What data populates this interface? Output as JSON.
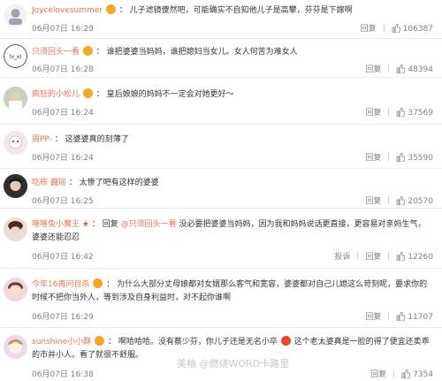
{
  "comments": [
    {
      "user": "Joycelovesummer",
      "badge": "emoji-orange",
      "text": "儿子滤镜傻然吧，可能确实不自知他儿子是高攀，芬芬是下嫁啊",
      "time": "06月07日 16:29",
      "reply": "回复",
      "likes": "106387"
    },
    {
      "user": "只须回头一看",
      "badge": "emoji-orange",
      "text": "谁把婆婆当妈妈，谁把媳妇当女儿。女人何苦为难女人",
      "time": "06月07日 16:28",
      "reply": "回复",
      "likes": "48394"
    },
    {
      "user": "疯狂的小松儿",
      "badge": "emoji-orange",
      "text": "皇后娘娘的妈妈不一定会对她更好～",
      "time": "06月07日 16:24",
      "reply": "回复",
      "likes": "37569"
    },
    {
      "user": "周PP-",
      "badge": "",
      "text": "这婆婆真的刻薄了",
      "time": "06月07日 16:24",
      "reply": "回复",
      "likes": "35590"
    },
    {
      "user": "吃栋 巍瑶",
      "badge": "",
      "text": "太惨了吧有这样的婆婆",
      "time": "06月07日 16:25",
      "reply": "回复",
      "likes": "20570"
    },
    {
      "user": "嘻嘻兔小魔王",
      "badge": "star",
      "text_prefix": "回复",
      "mention": "@只须回头一看",
      "text": "没必要把婆婆当妈妈，因为我和妈妈说话更直接，更容易对亲妈生气，婆婆还能忍忍",
      "time": "06月07日 16:42",
      "report": "投诉",
      "reply": "回复",
      "likes": "12260"
    },
    {
      "user": "今年16再问自杀",
      "badge": "emoji-orange",
      "text": "为什么大部分丈母娘都对女婿那么客气和宽容，婆婆都对自己儿媳这么苛刻呢，要求你的时候不把你当外人，等到涉及自身利益时，对不起你谁啊",
      "time": "06月07日 16:29",
      "reply": "回复",
      "likes": "11707"
    },
    {
      "user": "sunshine小小酥",
      "badge": "emoji-orange",
      "text_a": "啊哈哈哈。没有蔡少芬，你儿子还是无名小卒",
      "text_b": "这个老太婆真是一脸的得了便宜还卖乖的市井小人。看了就很不舒服。",
      "time": "06月07日 16:38",
      "reply": "回复",
      "likes": "7354"
    }
  ],
  "watermark": "美柚 @燃烧WORD卡路里",
  "colors": {
    "username": "#eb7350",
    "meta": "#808080",
    "emoji": "#f5a623",
    "emoji_red": "#e8452c",
    "star": "#f05a24"
  }
}
